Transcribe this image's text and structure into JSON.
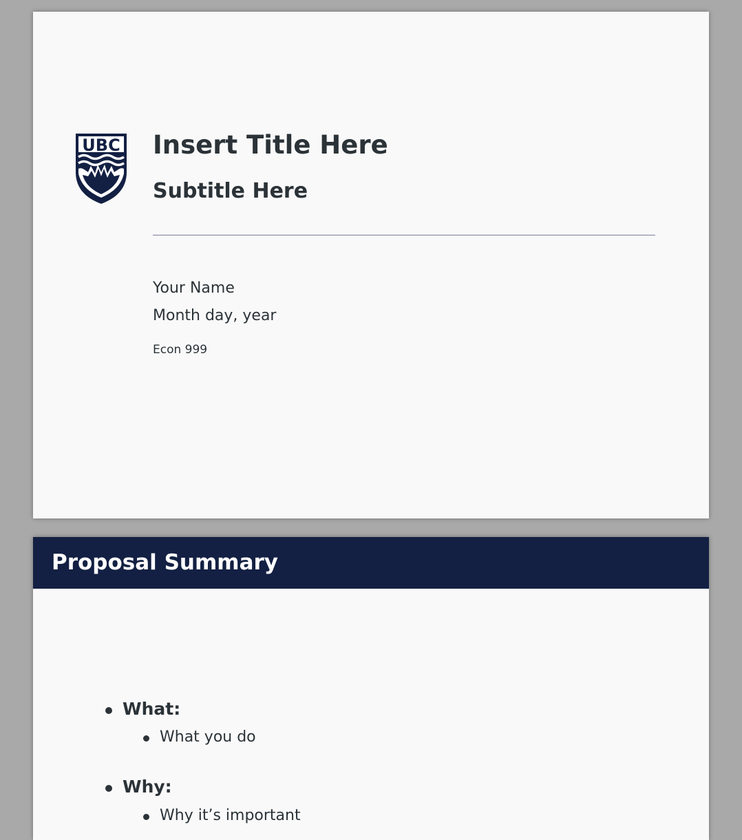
{
  "title_slide": {
    "logo_text": "UBC",
    "title": "Insert Title Here",
    "subtitle": "Subtitle Here",
    "author": "Your Name",
    "date": "Month day, year",
    "course": "Econ 999"
  },
  "summary_slide": {
    "header": "Proposal Summary",
    "items": [
      {
        "label": "What:",
        "sub": "What you do"
      },
      {
        "label": "Why:",
        "sub": "Why it’s important"
      }
    ]
  },
  "colors": {
    "navy": "#132043",
    "text": "#2b3338",
    "page": "#f9f9f9",
    "background": "#a9a9a9",
    "rule": "#7b8097"
  }
}
